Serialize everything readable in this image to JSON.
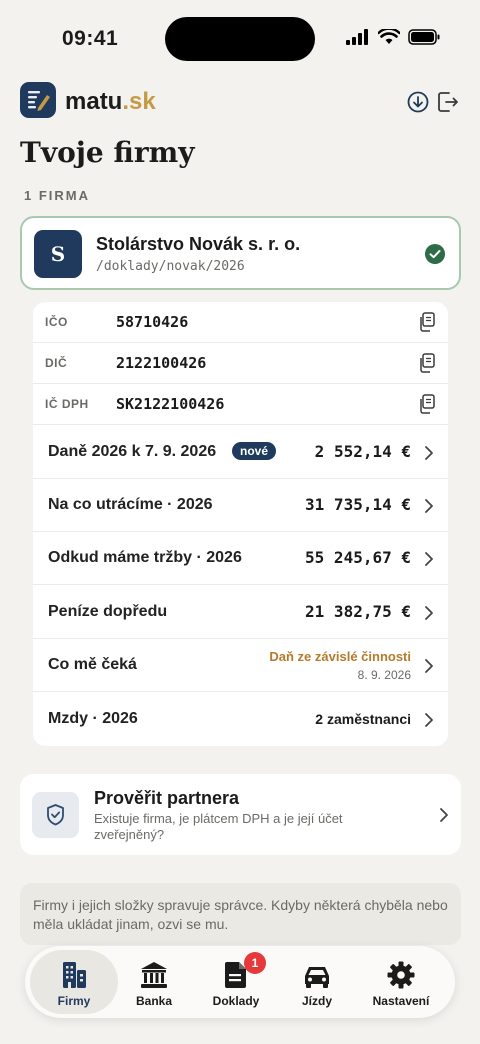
{
  "status_bar": {
    "time": "09:41"
  },
  "header": {
    "brand_main": "matu",
    "brand_tld": ".sk"
  },
  "page": {
    "title": "Tvoje firmy",
    "section_label": "1 FIRMA"
  },
  "company": {
    "initial": "S",
    "name": "Stolárstvo Novák s. r. o.",
    "path": "/doklady/novak/2026"
  },
  "ids": [
    {
      "key": "IČO",
      "value": "58710426"
    },
    {
      "key": "DIČ",
      "value": "2122100426"
    },
    {
      "key": "IČ DPH",
      "value": "SK2122100426"
    }
  ],
  "rows": {
    "taxes": {
      "label": "Daně 2026 k 7. 9. 2026",
      "badge": "nové",
      "amount": "2 552,14 €"
    },
    "spending": {
      "label": "Na co utrácíme · 2026",
      "amount": "31 735,14 €"
    },
    "revenue": {
      "label": "Odkud máme tržby · 2026",
      "amount": "55 245,67 €"
    },
    "cash_ahead": {
      "label": "Peníze dopředu",
      "amount": "21 382,75 €"
    },
    "upcoming": {
      "label": "Co mě čeká",
      "title": "Daň ze závislé činnosti",
      "date": "8. 9. 2026"
    },
    "payroll": {
      "label": "Mzdy · 2026",
      "value": "2 zaměstnanci"
    }
  },
  "partner": {
    "title": "Prověřit partnera",
    "description": "Existuje firma, je plátcem DPH a je její účet zveřejněný?"
  },
  "note": "Firmy i jejich složky spravuje správce. Kdyby některá chyběla nebo měla ukládat jinam, ozvi se mu.",
  "tabs": [
    {
      "label": "Firmy",
      "icon": "building-icon"
    },
    {
      "label": "Banka",
      "icon": "bank-icon"
    },
    {
      "label": "Doklady",
      "icon": "document-icon",
      "badge": "1"
    },
    {
      "label": "Jízdy",
      "icon": "car-icon"
    },
    {
      "label": "Nastavení",
      "icon": "gear-icon"
    }
  ],
  "colors": {
    "navy": "#1f3a5c",
    "gold": "#c39a45",
    "success": "#2e6b47",
    "warning": "#b67a2c",
    "badge_red": "#e5393c",
    "background": "#f4f2ee"
  }
}
